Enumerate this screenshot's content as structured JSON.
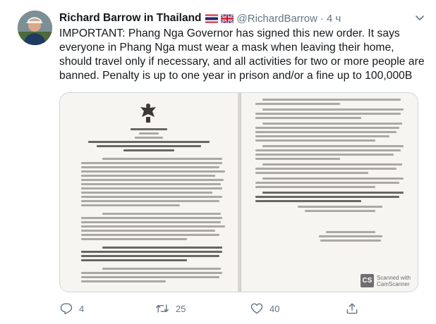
{
  "tweet": {
    "display_name": "Richard Barrow in Thailand",
    "handle": "@RichardBarrow",
    "separator": "·",
    "time": "4 ч",
    "text": "IMPORTANT: Phang Nga Governor has signed this new order. It says everyone in Phang Nga must wear a mask when leaving their home, should travel only if necessary, and all activities for two or more people are banned. Penalty is up to one year in prison and/or a fine up to 100,000B",
    "flags": [
      "thailand-flag-icon",
      "uk-flag-icon"
    ]
  },
  "media": {
    "watermark_logo": "CS",
    "watermark_line1": "Scanned with",
    "watermark_line2": "CamScanner"
  },
  "actions": {
    "reply_count": "4",
    "retweet_count": "25",
    "like_count": "40"
  },
  "colors": {
    "text": "#14171a",
    "secondary": "#657786",
    "border": "#ccd6dd"
  }
}
